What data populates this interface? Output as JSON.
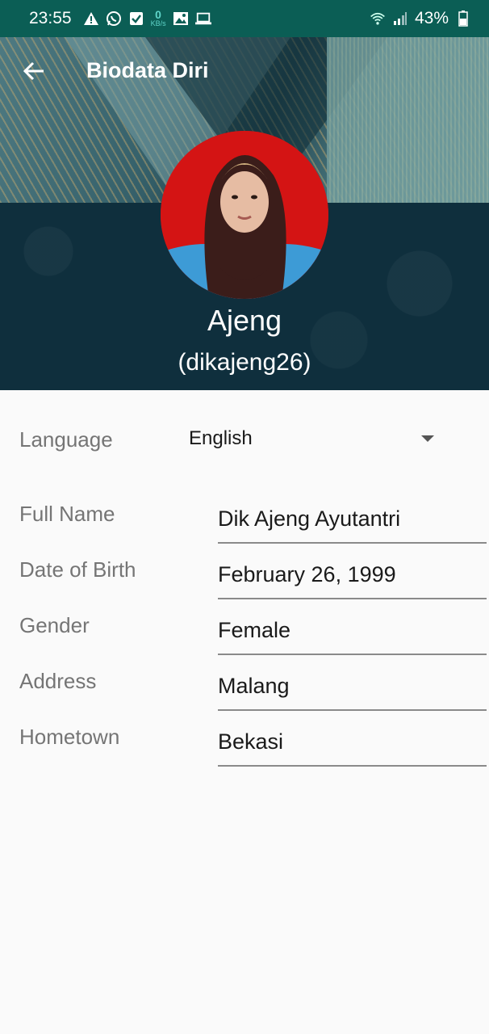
{
  "status_bar": {
    "time": "23:55",
    "net_speed_value": "0",
    "net_speed_unit": "KB/s",
    "battery": "43%",
    "icons": [
      "alert-icon",
      "whatsapp-icon",
      "check-box-icon",
      "net-speed-icon",
      "image-icon",
      "laptop-icon",
      "wifi-icon",
      "signal-icon",
      "battery-icon"
    ]
  },
  "app_bar": {
    "back_icon": "arrow-left-icon",
    "title": "Biodata Diri"
  },
  "profile": {
    "name": "Ajeng",
    "username": "(dikajeng26)"
  },
  "language": {
    "label": "Language",
    "selected": "English"
  },
  "fields": [
    {
      "label": "Full Name",
      "value": "Dik Ajeng Ayutantri"
    },
    {
      "label": "Date of Birth",
      "value": "February 26, 1999"
    },
    {
      "label": "Gender",
      "value": "Female"
    },
    {
      "label": "Address",
      "value": "Malang"
    },
    {
      "label": "Hometown",
      "value": "Bekasi"
    }
  ],
  "colors": {
    "status_bar": "#0b5e55",
    "header_dark": "#0f2f3d",
    "label_gray": "#757575",
    "avatar_bg": "#d41414"
  }
}
